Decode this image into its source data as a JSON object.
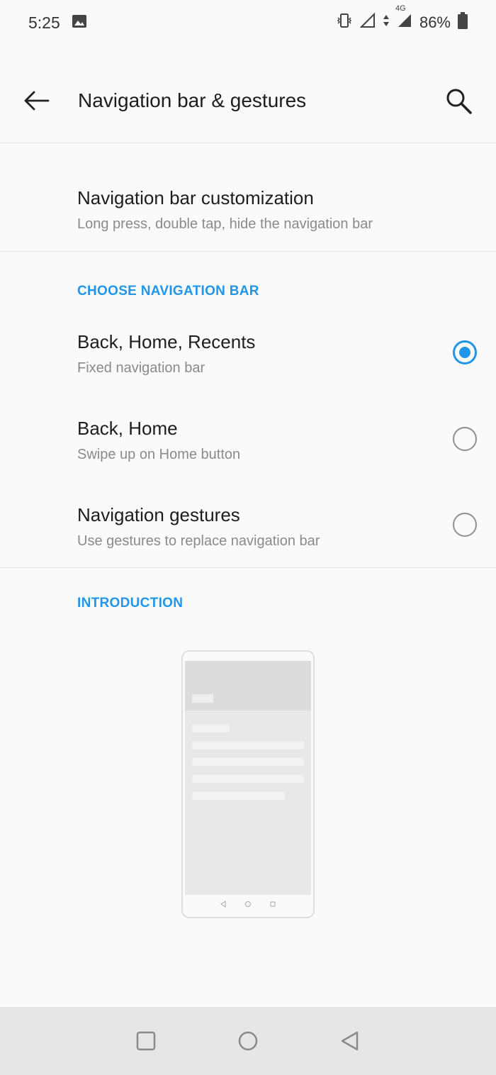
{
  "status_bar": {
    "time": "5:25",
    "network": "4G",
    "battery": "86%"
  },
  "header": {
    "title": "Navigation bar & gestures",
    "back_icon": "arrow-back-icon",
    "search_icon": "search-icon"
  },
  "customization": {
    "title": "Navigation bar customization",
    "subtitle": "Long press, double tap, hide the navigation bar"
  },
  "choose_section": {
    "header": "CHOOSE NAVIGATION BAR",
    "options": [
      {
        "title": "Back, Home, Recents",
        "subtitle": "Fixed navigation bar",
        "selected": true
      },
      {
        "title": "Back, Home",
        "subtitle": "Swipe up on Home button",
        "selected": false
      },
      {
        "title": "Navigation gestures",
        "subtitle": "Use gestures to replace navigation bar",
        "selected": false
      }
    ]
  },
  "introduction": {
    "header": "INTRODUCTION"
  },
  "colors": {
    "accent": "#2196e8",
    "background": "#fafafa",
    "nav_bar": "#e6e6e6"
  }
}
